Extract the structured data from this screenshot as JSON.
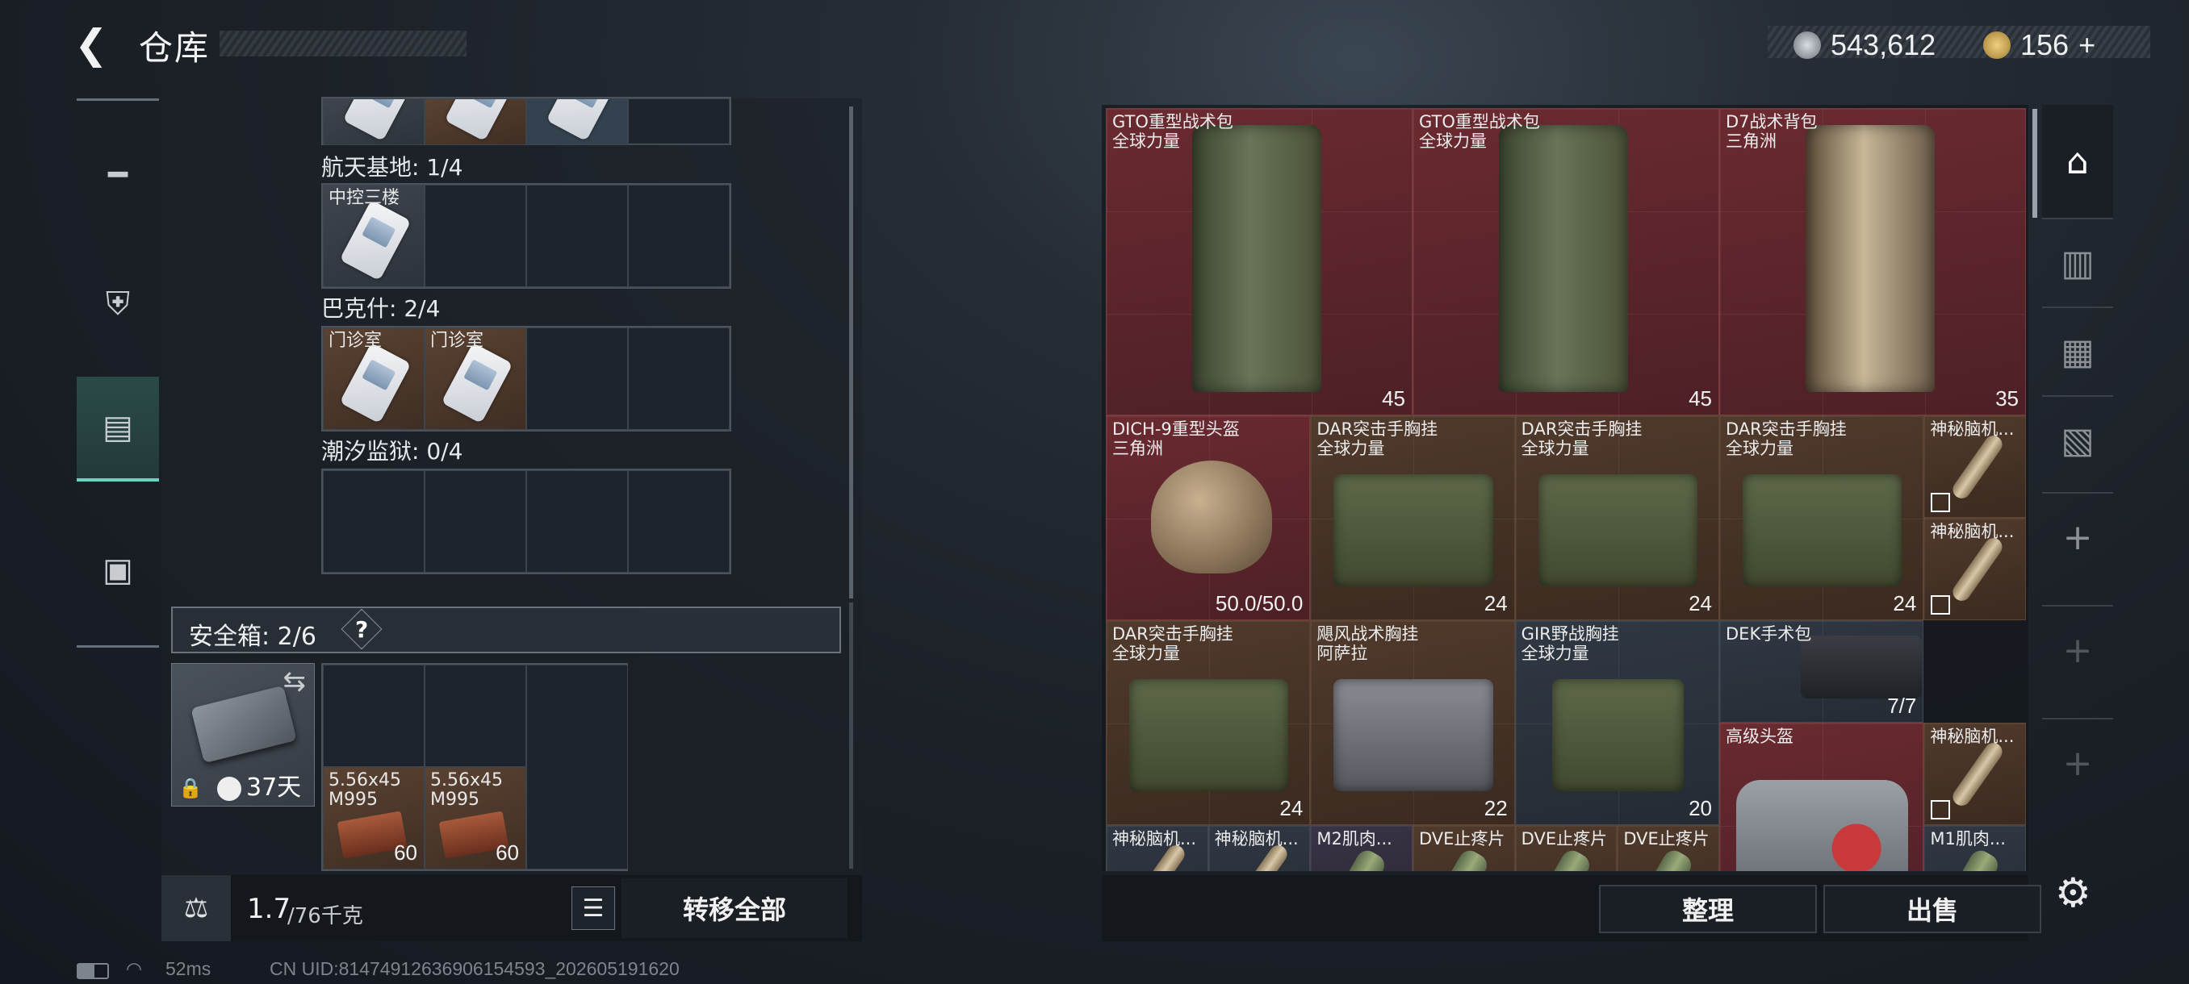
{
  "header": {
    "title": "仓库",
    "currency1": "543,612",
    "currency2": "156",
    "currency2_plus": "+"
  },
  "nav": {
    "items": [
      {
        "icon": "gun-icon"
      },
      {
        "icon": "armor-icon"
      },
      {
        "icon": "backpack-icon"
      },
      {
        "icon": "toolbox-icon"
      }
    ]
  },
  "left": {
    "sections": [
      {
        "label": "航天基地: 1/4",
        "items": [
          {
            "name": "中控三楼"
          }
        ]
      },
      {
        "label": "巴克什: 2/4",
        "items": [
          {
            "name": "门诊室"
          },
          {
            "name": "门诊室"
          }
        ]
      },
      {
        "label": "潮汐监狱: 0/4",
        "items": []
      }
    ],
    "safebox": {
      "label": "安全箱: 2/6",
      "help": "?",
      "days": "37天",
      "items": [
        {
          "name": "5.56x45 M995",
          "count": "60"
        },
        {
          "name": "5.56x45 M995",
          "count": "60"
        }
      ]
    },
    "weight_value": "1.7",
    "weight_max": "/76千克",
    "transfer_all": "转移全部"
  },
  "right": {
    "items": [
      {
        "name": "GTO重型战术包",
        "sub": "全球力量",
        "count": "45"
      },
      {
        "name": "GTO重型战术包",
        "sub": "全球力量",
        "count": "45"
      },
      {
        "name": "D7战术背包",
        "sub": "三角洲",
        "count": "35"
      },
      {
        "name": "DICH-9重型头盔",
        "sub": "三角洲",
        "count": "50.0/50.0"
      },
      {
        "name": "DAR突击手胸挂",
        "sub": "全球力量",
        "count": "24"
      },
      {
        "name": "DAR突击手胸挂",
        "sub": "全球力量",
        "count": "24"
      },
      {
        "name": "DAR突击手胸挂",
        "sub": "全球力量",
        "count": "24"
      },
      {
        "name": "神秘脑机...",
        "sub": "",
        "count": ""
      },
      {
        "name": "神秘脑机...",
        "sub": "",
        "count": ""
      },
      {
        "name": "DAR突击手胸挂",
        "sub": "全球力量",
        "count": "24"
      },
      {
        "name": "飓风战术胸挂",
        "sub": "阿萨拉",
        "count": "22"
      },
      {
        "name": "GIR野战胸挂",
        "sub": "全球力量",
        "count": "20"
      },
      {
        "name": "DEK手术包",
        "sub": "",
        "count": "7/7"
      },
      {
        "name": "高级头盔",
        "sub": "",
        "count": ""
      },
      {
        "name": "神秘脑机...",
        "sub": "",
        "count": ""
      },
      {
        "name": "神秘脑机...",
        "sub": "",
        "count": ""
      },
      {
        "name": "神秘脑机...",
        "sub": "",
        "count": ""
      },
      {
        "name": "M2肌肉...",
        "sub": "",
        "count": ""
      },
      {
        "name": "DVE止疼片",
        "sub": "",
        "count": ""
      },
      {
        "name": "DVE止疼片",
        "sub": "",
        "count": ""
      },
      {
        "name": "DVE止疼片",
        "sub": "",
        "count": ""
      },
      {
        "name": "M1肌肉...",
        "sub": "",
        "count": ""
      }
    ],
    "sort": "整理",
    "sell": "出售"
  },
  "side": {
    "add": "+"
  },
  "status": {
    "ping": "52ms",
    "uid": "CN UID:8147491263690615459​3_202605191620"
  }
}
